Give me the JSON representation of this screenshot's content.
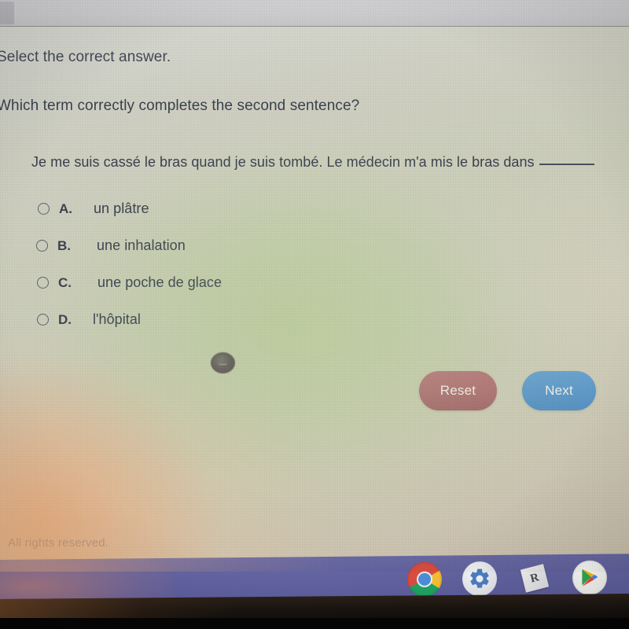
{
  "browser": {
    "tab_label": ""
  },
  "question": {
    "prompt": "Select the correct answer.",
    "stem": "Which term correctly completes the second sentence?",
    "sentence": "Je me suis cassé le bras quand je suis tombé. Le médecin m'a mis le bras dans",
    "blank": "______"
  },
  "options": [
    {
      "letter": "A.",
      "text": "un plâtre",
      "selected": false
    },
    {
      "letter": "B.",
      "text": "une inhalation",
      "selected": false
    },
    {
      "letter": "C.",
      "text": "une poche de glace",
      "selected": false
    },
    {
      "letter": "D.",
      "text": "l'hôpital",
      "selected": false
    }
  ],
  "buttons": {
    "reset_label": "Reset",
    "next_label": "Next"
  },
  "footer": {
    "copyright": "All rights reserved."
  },
  "taskbar": {
    "icons": [
      {
        "name": "chrome-icon",
        "label": "Chrome"
      },
      {
        "name": "settings-gear-icon",
        "label": "Settings"
      },
      {
        "name": "roblox-icon",
        "label": "R"
      },
      {
        "name": "google-play-icon",
        "label": "Play Store"
      }
    ]
  },
  "colors": {
    "reset_button": "#b06f76",
    "next_button": "#5d9acd",
    "taskbar": "#6263a1",
    "text": "#3b4250"
  }
}
